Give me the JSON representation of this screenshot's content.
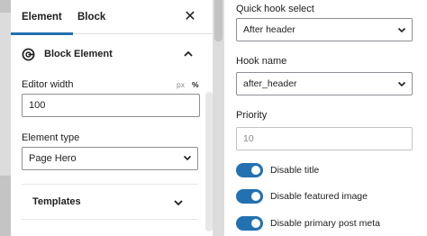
{
  "left_panel": {
    "tabs": [
      "Element",
      "Block"
    ],
    "close_icon": "close-icon",
    "section_title": "Block Element",
    "editor_width": {
      "label": "Editor width",
      "units": [
        "px",
        "%"
      ],
      "value": "100"
    },
    "element_type": {
      "label": "Element type",
      "value": "Page Hero"
    },
    "templates_label": "Templates"
  },
  "right_panel": {
    "quick_hook": {
      "label": "Quick hook select",
      "value": "After header"
    },
    "hook_name": {
      "label": "Hook name",
      "value": "after_header"
    },
    "priority": {
      "label": "Priority",
      "placeholder": "10"
    },
    "toggles": [
      {
        "label": "Disable title",
        "on": true
      },
      {
        "label": "Disable featured image",
        "on": true
      },
      {
        "label": "Disable primary post meta",
        "on": true
      }
    ]
  },
  "colors": {
    "accent": "#2271b1"
  }
}
